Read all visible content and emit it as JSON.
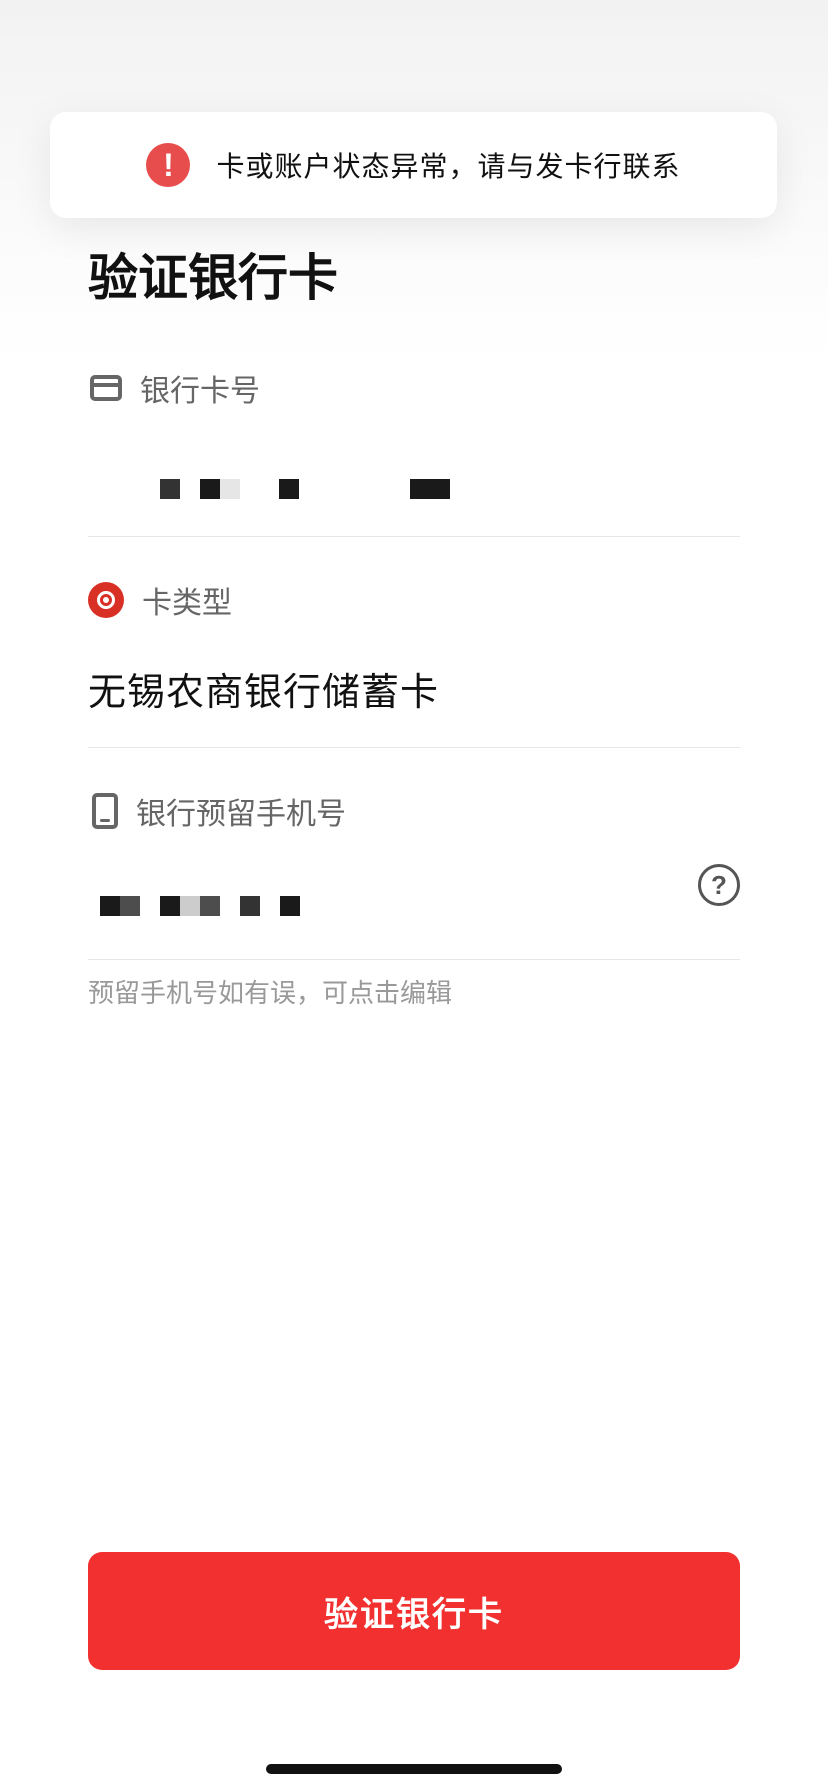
{
  "toast": {
    "icon": "exclamation-icon",
    "message": "卡或账户状态异常，请与发卡行联系"
  },
  "page": {
    "title": "验证银行卡"
  },
  "fields": {
    "card_number": {
      "icon": "card-icon",
      "label": "银行卡号",
      "value_masked": true
    },
    "card_type": {
      "icon": "bank-logo-icon",
      "label": "卡类型",
      "value": "无锡农商银行储蓄卡"
    },
    "phone": {
      "icon": "phone-icon",
      "label": "银行预留手机号",
      "value_masked": true,
      "help_icon": "question-icon",
      "hint": "预留手机号如有误，可点击编辑"
    }
  },
  "actions": {
    "verify_label": "验证银行卡"
  },
  "colors": {
    "accent": "#f23030",
    "error_icon": "#e74d4d",
    "bank_logo": "#d93026"
  }
}
